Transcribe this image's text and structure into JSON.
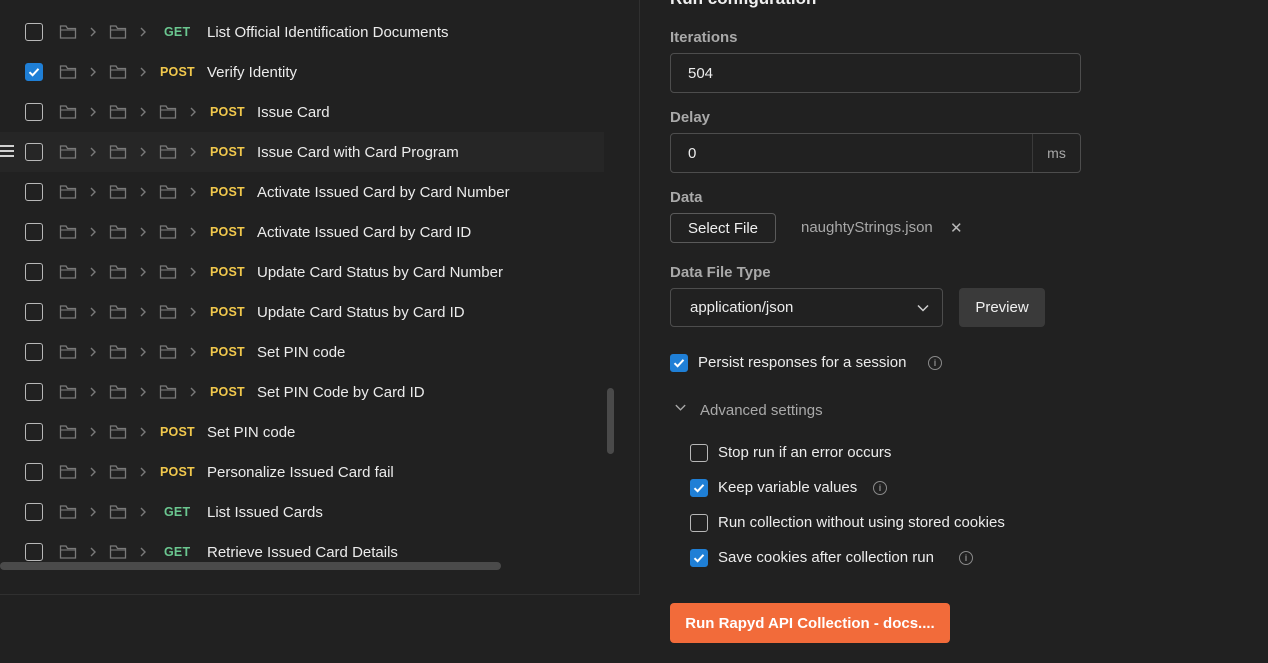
{
  "requests": [
    {
      "checked": false,
      "depth": 2,
      "method": "GET",
      "name": "List Official Identification Documents",
      "hover": false
    },
    {
      "checked": true,
      "depth": 2,
      "method": "POST",
      "name": "Verify Identity",
      "hover": false
    },
    {
      "checked": false,
      "depth": 3,
      "method": "POST",
      "name": "Issue Card",
      "hover": false
    },
    {
      "checked": false,
      "depth": 3,
      "method": "POST",
      "name": "Issue Card with Card Program",
      "hover": true
    },
    {
      "checked": false,
      "depth": 3,
      "method": "POST",
      "name": "Activate Issued Card by Card Number",
      "hover": false
    },
    {
      "checked": false,
      "depth": 3,
      "method": "POST",
      "name": "Activate Issued Card by Card ID",
      "hover": false
    },
    {
      "checked": false,
      "depth": 3,
      "method": "POST",
      "name": "Update Card Status by Card Number",
      "hover": false
    },
    {
      "checked": false,
      "depth": 3,
      "method": "POST",
      "name": "Update Card Status by Card ID",
      "hover": false
    },
    {
      "checked": false,
      "depth": 3,
      "method": "POST",
      "name": "Set PIN code",
      "hover": false
    },
    {
      "checked": false,
      "depth": 3,
      "method": "POST",
      "name": "Set PIN Code by Card ID",
      "hover": false
    },
    {
      "checked": false,
      "depth": 2,
      "method": "POST",
      "name": "Set PIN code",
      "hover": false
    },
    {
      "checked": false,
      "depth": 2,
      "method": "POST",
      "name": "Personalize Issued Card fail",
      "hover": false
    },
    {
      "checked": false,
      "depth": 2,
      "method": "GET",
      "name": "List Issued Cards",
      "hover": false
    },
    {
      "checked": false,
      "depth": 2,
      "method": "GET",
      "name": "Retrieve Issued Card Details",
      "hover": false
    }
  ],
  "config": {
    "title": "Run configuration",
    "iterations_label": "Iterations",
    "iterations_value": "504",
    "delay_label": "Delay",
    "delay_value": "0",
    "delay_unit": "ms",
    "data_label": "Data",
    "select_file_label": "Select File",
    "file_name": "naughtyStrings.json",
    "file_remove": "✕",
    "data_file_type_label": "Data File Type",
    "data_file_type_value": "application/json",
    "preview_label": "Preview",
    "persist_label": "Persist responses for a session",
    "persist_checked": true,
    "advanced_label": "Advanced settings",
    "advanced": [
      {
        "label": "Stop run if an error occurs",
        "checked": false,
        "info": false
      },
      {
        "label": "Keep variable values",
        "checked": true,
        "info": true
      },
      {
        "label": "Run collection without using stored cookies",
        "checked": false,
        "info": false
      },
      {
        "label": "Save cookies after collection run",
        "checked": true,
        "info": true
      }
    ],
    "run_button_label": "Run Rapyd API Collection - docs...."
  },
  "colors": {
    "accent": "#1f7fd6",
    "run_button": "#f26b3a",
    "get_method": "#6bc790",
    "post_method": "#f2c94c"
  }
}
